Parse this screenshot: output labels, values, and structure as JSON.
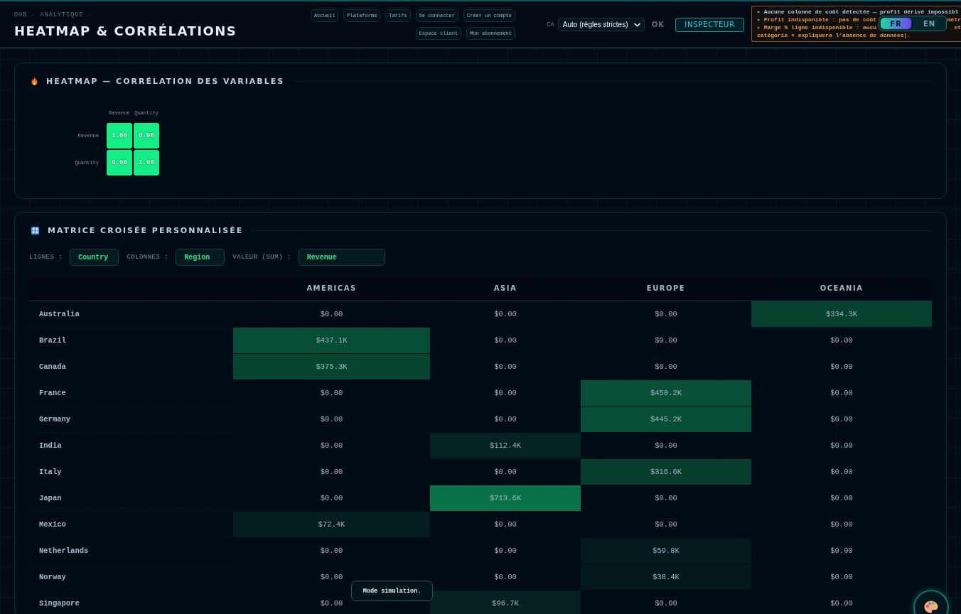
{
  "header": {
    "breadcrumb": "OHB · ANALYTIQUE ·",
    "title": "HEATMAP & CORRÉLATIONS",
    "nav_links": [
      "Accueil",
      "Plateforme",
      "Tarifs",
      "Se connecter",
      "Créer un compte",
      "Espace client",
      "Mon abonnement"
    ],
    "metric_label": "CA",
    "mode_select": {
      "value": "Auto (règles strictes)"
    },
    "status": "OK",
    "inspector_button": "INSPECTEUR",
    "notices": [
      {
        "kind": "info",
        "segments": [
          "▸ Aucune colonne de coût détectée — profit dérivé impossibl"
        ]
      },
      {
        "kind": "warning",
        "segments": [
          "▸ Profit indisponible : pas de coût",
          "métr"
        ]
      },
      {
        "kind": "warning",
        "segments": [
          "▸ Marge % ligne indisponible : aucu",
          "et"
        ]
      },
      {
        "kind": "warning",
        "segments": [
          "catégorie » expliquera l’absence de données)."
        ]
      }
    ],
    "language_toggle": [
      {
        "label": "FR",
        "selected": true
      },
      {
        "label": "EN",
        "selected": false
      }
    ]
  },
  "correlation_card": {
    "title": "HEATMAP — CORRÉLATION DES VARIABLES",
    "columns": [
      "Revenue",
      "Quantity"
    ],
    "rows": [
      {
        "label": "Revenue",
        "cells": [
          "1.00",
          "0.96"
        ]
      },
      {
        "label": "Quantity",
        "cells": [
          "0.96",
          "1.00"
        ]
      }
    ]
  },
  "pivot_card": {
    "title": "MATRICE CROISÉE PERSONNALISÉE",
    "controls": [
      {
        "label": "LIGNES :",
        "value": "Country"
      },
      {
        "label": "COLONNES :",
        "value": "Region"
      },
      {
        "label": "VALEUR (SUM) :",
        "value": "Revenue"
      }
    ],
    "columns": [
      "AMERICAS",
      "ASIA",
      "EUROPE",
      "OCEANIA"
    ],
    "rows": [
      {
        "label": "Australia",
        "cells": [
          {
            "value": "$0.00"
          },
          {
            "value": "$0.00"
          },
          {
            "value": "$0.00"
          },
          {
            "value": "$334.3K",
            "color": "#06402f"
          }
        ]
      },
      {
        "label": "Brazil",
        "cells": [
          {
            "value": "$437.1K",
            "color": "#074d35"
          },
          {
            "value": "$0.00"
          },
          {
            "value": "$0.00"
          },
          {
            "value": "$0.00"
          }
        ]
      },
      {
        "label": "Canada",
        "cells": [
          {
            "value": "$375.3K",
            "color": "#064631"
          },
          {
            "value": "$0.00"
          },
          {
            "value": "$0.00"
          },
          {
            "value": "$0.00"
          }
        ]
      },
      {
        "label": "France",
        "cells": [
          {
            "value": "$0.00"
          },
          {
            "value": "$0.00"
          },
          {
            "value": "$450.2K",
            "color": "#074f36"
          },
          {
            "value": "$0.00"
          }
        ]
      },
      {
        "label": "Germany",
        "cells": [
          {
            "value": "$0.00"
          },
          {
            "value": "$0.00"
          },
          {
            "value": "$445.2K",
            "color": "#074e36"
          },
          {
            "value": "$0.00"
          }
        ]
      },
      {
        "label": "India",
        "cells": [
          {
            "value": "$0.00"
          },
          {
            "value": "$112.4K",
            "color": "#042220"
          },
          {
            "value": "$0.00"
          },
          {
            "value": "$0.00"
          }
        ]
      },
      {
        "label": "Italy",
        "cells": [
          {
            "value": "$0.00"
          },
          {
            "value": "$0.00"
          },
          {
            "value": "$316.6K",
            "color": "#063d2d"
          },
          {
            "value": "$0.00"
          }
        ]
      },
      {
        "label": "Japan",
        "cells": [
          {
            "value": "$0.00"
          },
          {
            "value": "$713.6K",
            "color": "#0a7248"
          },
          {
            "value": "$0.00"
          },
          {
            "value": "$0.00"
          }
        ]
      },
      {
        "label": "Mexico",
        "cells": [
          {
            "value": "$72.4K",
            "color": "#031c1d"
          },
          {
            "value": "$0.00"
          },
          {
            "value": "$0.00"
          },
          {
            "value": "$0.00"
          }
        ]
      },
      {
        "label": "Netherlands",
        "cells": [
          {
            "value": "$0.00"
          },
          {
            "value": "$0.00"
          },
          {
            "value": "$59.8K",
            "color": "#031a1c"
          },
          {
            "value": "$0.00"
          }
        ]
      },
      {
        "label": "Norway",
        "cells": [
          {
            "value": "$0.00"
          },
          {
            "value": "$0.00"
          },
          {
            "value": "$38.4K",
            "color": "#03181a"
          },
          {
            "value": "$0.00"
          }
        ]
      },
      {
        "label": "Singapore",
        "cells": [
          {
            "value": "$0.00"
          },
          {
            "value": "$96.7K",
            "color": "#04201f"
          },
          {
            "value": "$0.00"
          },
          {
            "value": "$0.00"
          }
        ]
      }
    ]
  },
  "toast": "Mode simulation."
}
